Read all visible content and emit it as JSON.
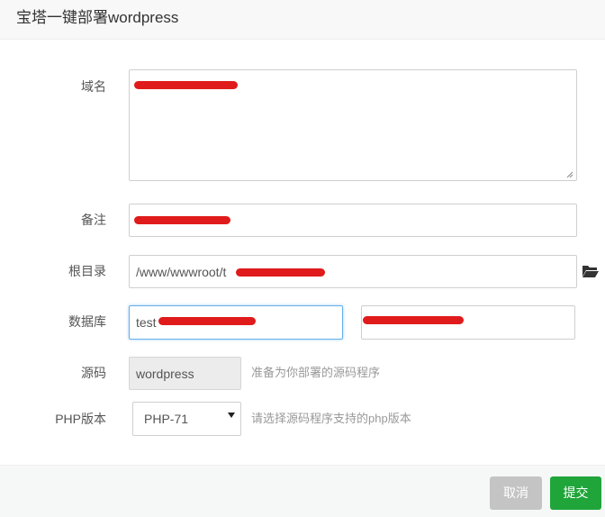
{
  "dialog": {
    "title": "宝塔一键部署wordpress"
  },
  "form": {
    "domain": {
      "label": "域名",
      "value": ""
    },
    "remark": {
      "label": "备注",
      "value": ""
    },
    "root": {
      "label": "根目录",
      "value": "/www/wwwroot/t",
      "icon": "folder-open-icon"
    },
    "database": {
      "label": "数据库",
      "name_value": "test",
      "password_value": ""
    },
    "source": {
      "label": "源码",
      "value": "wordpress",
      "hint": "准备为你部署的源码程序"
    },
    "php": {
      "label": "PHP版本",
      "selected": "PHP-71",
      "hint": "请选择源码程序支持的php版本"
    }
  },
  "footer": {
    "cancel_label": "取消",
    "submit_label": "提交"
  },
  "colors": {
    "redaction": "#e01b1b",
    "submit": "#20a53a",
    "cancel": "#c4c4c4",
    "focus": "#66afe9"
  }
}
